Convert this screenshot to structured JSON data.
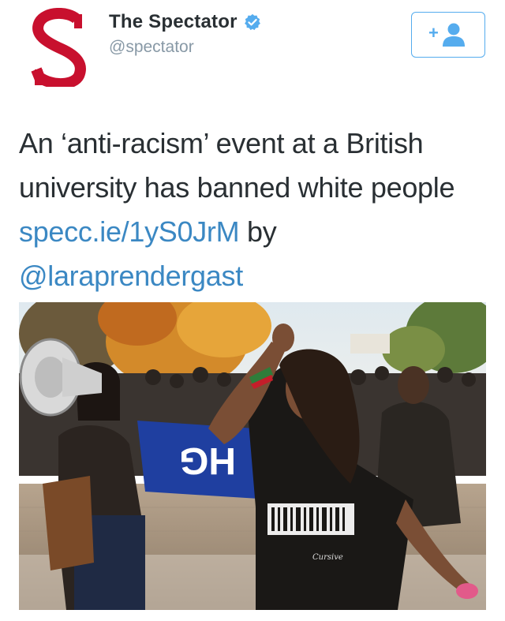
{
  "account": {
    "name": "The Spectator",
    "handle": "@spectator",
    "avatar_letter": "S",
    "avatar_color": "#c8102e",
    "verified": true
  },
  "follow_button": {
    "icon": "add-user-icon",
    "color": "#55acee"
  },
  "tweet": {
    "text_before": "An ‘anti-racism’ event at a British university has banned white people",
    "link": "specc.ie/1yS0JrM",
    "text_middle": "by",
    "mention": "@laraprendergast"
  },
  "media": {
    "sign_text": "HG",
    "shirt_text": "Cursive",
    "link_color": "#3b88c3"
  }
}
